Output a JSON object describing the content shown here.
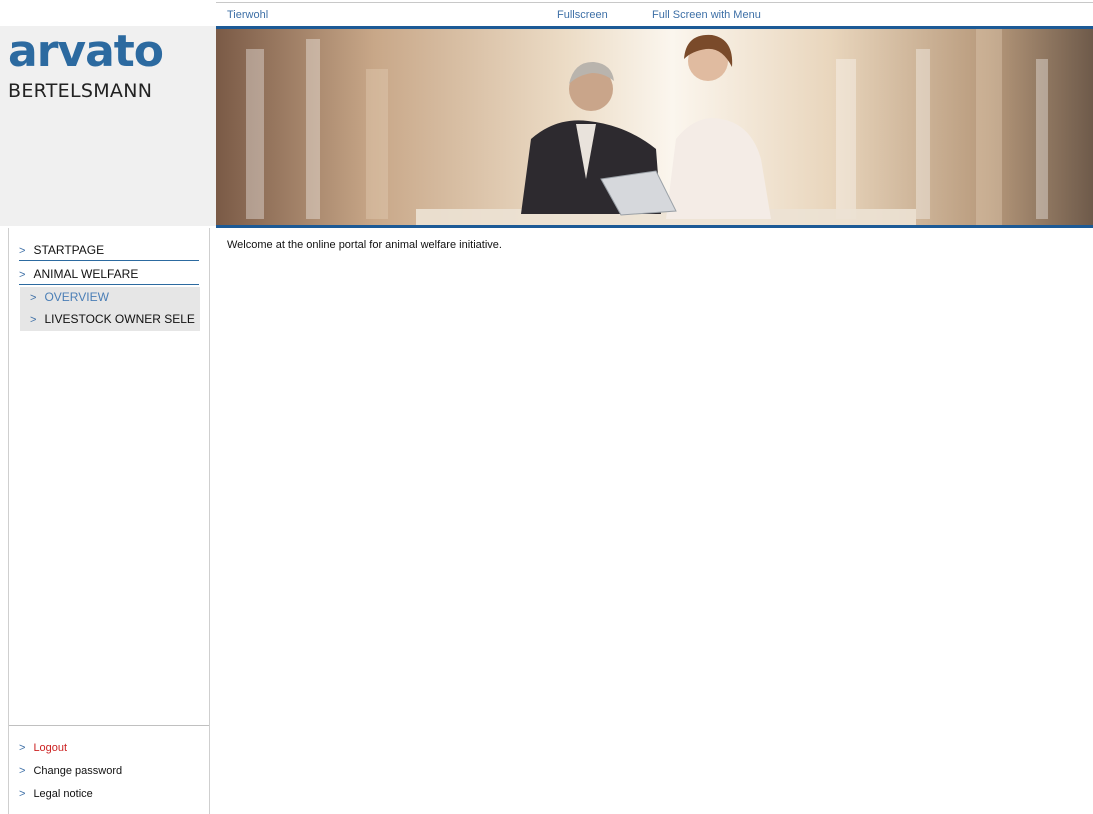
{
  "topnav": {
    "items": [
      {
        "label": "Tierwohl"
      },
      {
        "label": "Fullscreen"
      },
      {
        "label": "Full Screen with Menu"
      }
    ]
  },
  "logo": {
    "brand": "arvato",
    "subtitle": "BERTELSMANN",
    "brand_color": "#2c6aa0"
  },
  "sidebar": {
    "items": [
      {
        "label": "STARTPAGE",
        "icon": "chevron-right-icon"
      },
      {
        "label": "ANIMAL WELFARE",
        "icon": "chevron-right-icon"
      }
    ],
    "subitems": [
      {
        "label": "OVERVIEW",
        "active": true,
        "icon": "chevron-right-icon"
      },
      {
        "label": "LIVESTOCK OWNER SELE",
        "active": false,
        "icon": "chevron-right-icon"
      }
    ],
    "bottom": [
      {
        "label": "Logout",
        "color": "#cc2222"
      },
      {
        "label": "Change password"
      },
      {
        "label": "Legal notice"
      }
    ]
  },
  "main": {
    "welcome_text": "Welcome at the online portal for animal welfare initiative."
  },
  "colors": {
    "accent": "#1c5a96",
    "link": "#3d6fa6"
  }
}
